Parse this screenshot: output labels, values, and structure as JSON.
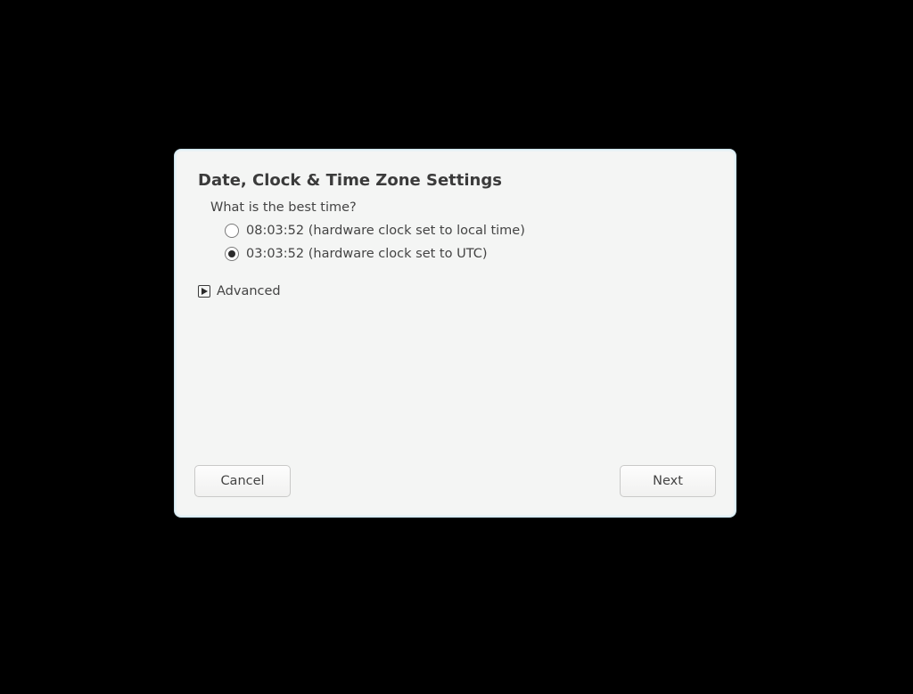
{
  "dialog": {
    "title": "Date, Clock & Time Zone Settings",
    "prompt": "What is the best time?",
    "options": {
      "local": "08:03:52 (hardware clock set to local time)",
      "utc": "03:03:52 (hardware clock set to UTC)"
    },
    "advanced_label": "Advanced"
  },
  "buttons": {
    "cancel": "Cancel",
    "next": "Next"
  }
}
